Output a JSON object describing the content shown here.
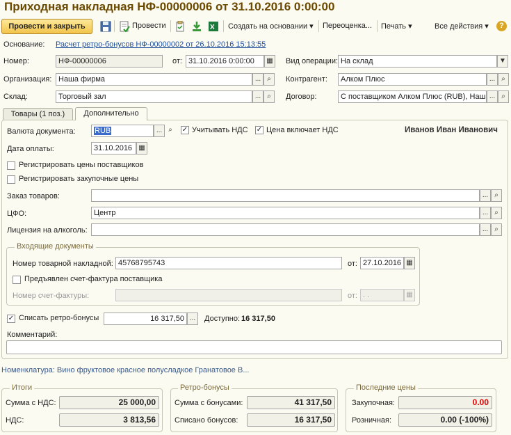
{
  "title": "Приходная накладная НФ-00000006 от 31.10.2016 0:00:00",
  "toolbar": {
    "post_close": "Провести и закрыть",
    "post": "Провести",
    "create_based": "Создать на основании",
    "reprice": "Переоценка...",
    "print": "Печать",
    "all_actions": "Все действия"
  },
  "header": {
    "basis_label": "Основание:",
    "basis_link": "Расчет ретро-бонусов НФ-00000002 от 26.10.2016 15:13:55",
    "number_label": "Номер:",
    "number_value": "НФ-00000006",
    "from_label": "от:",
    "date_value": "31.10.2016  0:00:00",
    "op_label": "Вид операции:",
    "op_value": "На склад",
    "org_label": "Организация:",
    "org_value": "Наша фирма",
    "contractor_label": "Контрагент:",
    "contractor_value": "Алком Плюс",
    "warehouse_label": "Склад:",
    "warehouse_value": "Торговый зал",
    "contract_label": "Договор:",
    "contract_value": "С поставщиком Алком Плюс (RUB), Наша фирма"
  },
  "tabs": [
    {
      "label": "Товары (1 поз.)"
    },
    {
      "label": "Дополнительно"
    }
  ],
  "extra": {
    "currency_label": "Валюта документа:",
    "currency_value": "RUB",
    "vat_check": "Учитывать НДС",
    "price_incl_vat": "Цена включает НДС",
    "responsible": "Иванов Иван Иванович",
    "pay_date_label": "Дата оплаты:",
    "pay_date_value": "31.10.2016",
    "reg_supplier_prices": "Регистрировать цены поставщиков",
    "reg_purchase_prices": "Регистрировать закупочные цены",
    "order_label": "Заказ товаров:",
    "cfo_label": "ЦФО:",
    "cfo_value": "Центр",
    "license_label": "Лицензия на алкоголь:",
    "incoming_group": "Входящие документы",
    "waybill_label": "Номер товарной накладной:",
    "waybill_value": "45768795743",
    "waybill_from": "от:",
    "waybill_date": "27.10.2016",
    "invoice_presented": "Предъявлен счет-фактура поставщика",
    "invoice_num_label": "Номер счет-фактуры:",
    "invoice_from": "от:",
    "invoice_date": " .  .",
    "retro_label": "Списать ретро-бонусы",
    "retro_value": "16 317,50",
    "available_label": "Доступно:",
    "available_value": "16 317,50",
    "comment_label": "Комментарий:"
  },
  "nomenclature": "Номенклатура: Вино фруктовое красное полусладкое Гранатовое В...",
  "totals": {
    "group": "Итоги",
    "sum_vat_label": "Сумма с НДС:",
    "sum_vat_value": "25 000,00",
    "vat_label": "НДС:",
    "vat_value": "3 813,56"
  },
  "retro": {
    "group": "Ретро-бонусы",
    "sum_bonus_label": "Сумма с бонусами:",
    "sum_bonus_value": "41 317,50",
    "written_label": "Списано бонусов:",
    "written_value": "16 317,50"
  },
  "last_prices": {
    "group": "Последние цены",
    "purchase_label": "Закупочная:",
    "purchase_value": "0.00",
    "retail_label": "Розничная:",
    "retail_value": "0.00 (-100%)"
  },
  "colors": {
    "accent": "#6b4a00",
    "link": "#1f4e9a",
    "warning": "#e00000"
  }
}
